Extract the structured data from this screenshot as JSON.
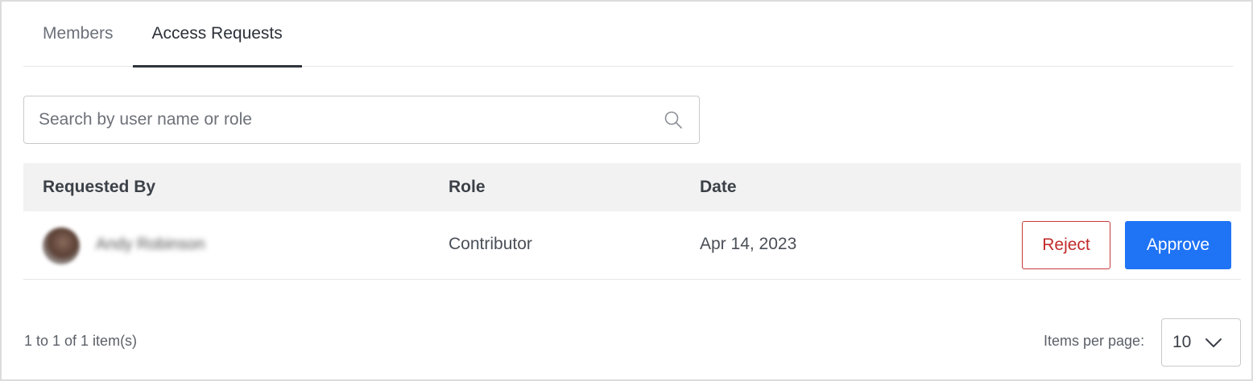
{
  "tabs": [
    {
      "label": "Members",
      "active": false
    },
    {
      "label": "Access Requests",
      "active": true
    }
  ],
  "search": {
    "placeholder": "Search by user name or role",
    "value": "",
    "icon": "search-icon"
  },
  "table": {
    "columns": [
      "Requested By",
      "Role",
      "Date"
    ],
    "rows": [
      {
        "user": "Andy Robinson",
        "role": "Contributor",
        "date": "Apr 14, 2023",
        "reject_label": "Reject",
        "approve_label": "Approve"
      }
    ]
  },
  "pagination": {
    "summary": "1 to 1 of 1 item(s)",
    "items_per_page_label": "Items per page:",
    "items_per_page_value": "10",
    "icon": "chevron-down-icon"
  },
  "colors": {
    "accent": "#1f73f5",
    "danger": "#c22b2b",
    "header_bg": "#f2f2f2"
  }
}
